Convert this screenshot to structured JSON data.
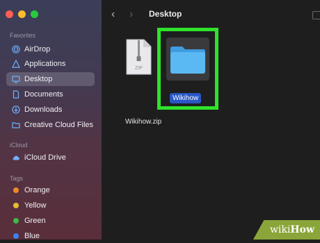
{
  "window_controls": {
    "close_color": "#fe5f57",
    "minimize_color": "#febc2e",
    "zoom_color": "#28c840"
  },
  "sidebar": {
    "favorites_label": "Favorites",
    "favorites": [
      {
        "label": "AirDrop",
        "icon": "airdrop-icon"
      },
      {
        "label": "Applications",
        "icon": "applications-icon"
      },
      {
        "label": "Desktop",
        "icon": "desktop-icon",
        "selected": true
      },
      {
        "label": "Documents",
        "icon": "document-icon"
      },
      {
        "label": "Downloads",
        "icon": "download-icon"
      },
      {
        "label": "Creative Cloud Files",
        "icon": "folder-icon"
      }
    ],
    "icloud_label": "iCloud",
    "icloud": [
      {
        "label": "iCloud Drive",
        "icon": "cloud-icon"
      }
    ],
    "tags_label": "Tags",
    "tags": [
      {
        "label": "Orange",
        "color": "#f0892b"
      },
      {
        "label": "Yellow",
        "color": "#e6bd32"
      },
      {
        "label": "Green",
        "color": "#3fba4a"
      },
      {
        "label": "Blue",
        "color": "#3b82f6"
      }
    ]
  },
  "toolbar": {
    "title": "Desktop",
    "back_glyph": "‹",
    "forward_glyph": "›"
  },
  "files": [
    {
      "name": "Wikihow.zip",
      "type": "zip",
      "icon_text": "ZIP"
    },
    {
      "name": "Wikihow",
      "type": "folder",
      "selected": true
    }
  ],
  "colors": {
    "accent": "#2856c6",
    "highlight_box": "#2fe32c",
    "folder": "#5ab8f2"
  },
  "watermark": {
    "part1": "wiki",
    "part2": "How"
  }
}
